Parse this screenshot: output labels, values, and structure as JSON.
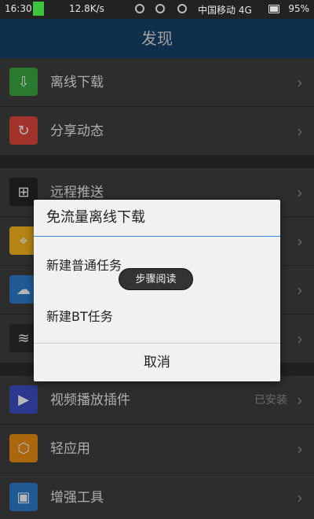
{
  "status_bar": {
    "time": "16:30",
    "speed": "12.8K/s",
    "carrier": "中国移动 4G",
    "network": "4G",
    "battery": "95%"
  },
  "header": {
    "title": "发现",
    "background": "#153f66"
  },
  "list": {
    "items": [
      {
        "label": "离线下载",
        "status": "",
        "icon": "download-icon",
        "color": "#37a33e"
      },
      {
        "label": "分享动态",
        "status": "",
        "icon": "share-icon",
        "color": "#d9453a"
      },
      {
        "label": "远程推送",
        "status": "",
        "icon": "remote-push-icon",
        "color": "#232323"
      },
      {
        "label": "",
        "status": "",
        "icon": "location-icon",
        "color": "#f0b21b"
      },
      {
        "label": "",
        "status": "",
        "icon": "cloud-phone-icon",
        "color": "#2a79c7"
      },
      {
        "label": "",
        "status": "",
        "icon": "wifi-icon",
        "color": "#2a2a2a"
      },
      {
        "label": "视频播放插件",
        "status": "已安装",
        "icon": "play-icon",
        "color": "#3a4bbd"
      },
      {
        "label": "轻应用",
        "status": "",
        "icon": "light-app-icon",
        "color": "#e58a12"
      },
      {
        "label": "增强工具",
        "status": "",
        "icon": "toolbox-icon",
        "color": "#2a79c7"
      }
    ]
  },
  "dialog": {
    "title": "免流量离线下载",
    "options": [
      "新建普通任务",
      "新建BT任务"
    ],
    "cancel": "取消"
  },
  "overlay_pill": {
    "label": "步骤阅读"
  },
  "colors": {
    "dialog_divider": "#3b8bd8"
  }
}
